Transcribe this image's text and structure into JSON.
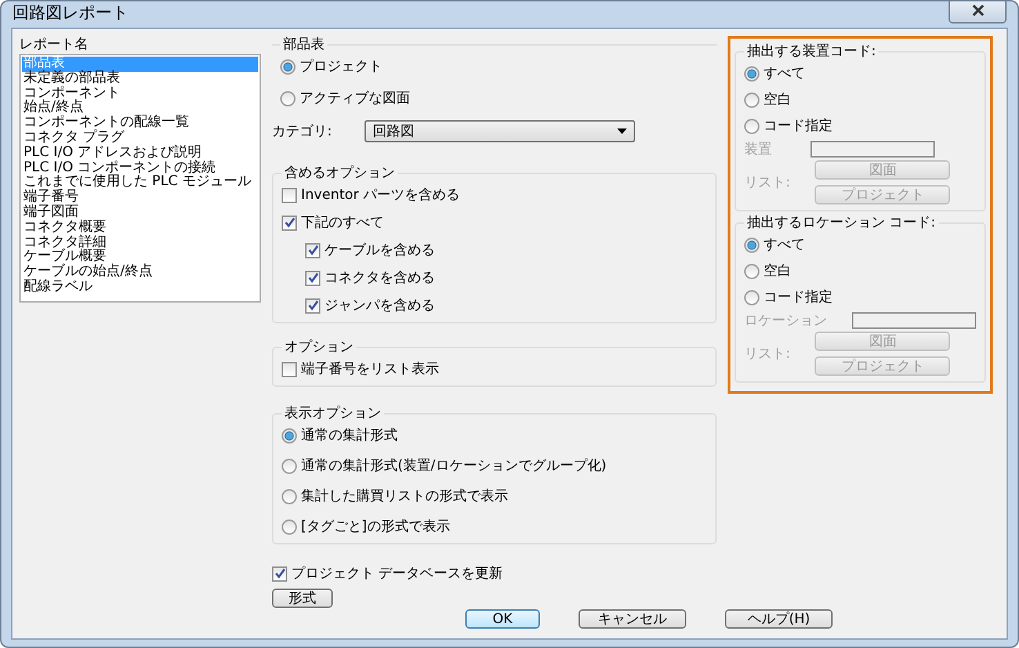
{
  "window": {
    "title": "回路図レポート"
  },
  "report_list": {
    "label": "レポート名",
    "items": [
      {
        "label": "部品表",
        "selected": true
      },
      {
        "label": "未定義の部品表",
        "selected": false
      },
      {
        "label": "コンポーネント",
        "selected": false
      },
      {
        "label": "始点/終点",
        "selected": false
      },
      {
        "label": "コンポーネントの配線一覧",
        "selected": false
      },
      {
        "label": "コネクタ プラグ",
        "selected": false
      },
      {
        "label": "PLC I/O アドレスおよび説明",
        "selected": false
      },
      {
        "label": "PLC I/O コンポーネントの接続",
        "selected": false
      },
      {
        "label": "これまでに使用した PLC モジュール",
        "selected": false
      },
      {
        "label": "端子番号",
        "selected": false
      },
      {
        "label": "端子図面",
        "selected": false
      },
      {
        "label": "コネクタ概要",
        "selected": false
      },
      {
        "label": "コネクタ詳細",
        "selected": false
      },
      {
        "label": "ケーブル概要",
        "selected": false
      },
      {
        "label": "ケーブルの始点/終点",
        "selected": false
      },
      {
        "label": "配線ラベル",
        "selected": false
      }
    ]
  },
  "parts_table": {
    "title": "部品表",
    "scope": [
      {
        "label": "プロジェクト",
        "selected": true
      },
      {
        "label": "アクティブな図面",
        "selected": false
      }
    ],
    "category": {
      "label": "カテゴリ:",
      "value": "回路図"
    }
  },
  "include_options": {
    "title": "含めるオプション",
    "items": [
      {
        "label": "Inventor パーツを含める",
        "checked": false
      },
      {
        "label": "下記のすべて",
        "checked": true,
        "children": [
          {
            "label": "ケーブルを含める",
            "checked": true
          },
          {
            "label": "コネクタを含める",
            "checked": true
          },
          {
            "label": "ジャンパを含める",
            "checked": true
          }
        ]
      }
    ]
  },
  "options": {
    "title": "オプション",
    "items": [
      {
        "label": "端子番号をリスト表示",
        "checked": false
      }
    ]
  },
  "display_options": {
    "title": "表示オプション",
    "items": [
      {
        "label": "通常の集計形式",
        "selected": true
      },
      {
        "label": "通常の集計形式(装置/ロケーションでグループ化)",
        "selected": false
      },
      {
        "label": "集計した購買リストの形式で表示",
        "selected": false
      },
      {
        "label": "[タグごと]の形式で表示",
        "selected": false
      }
    ]
  },
  "update_db": {
    "label": "プロジェクト データベースを更新",
    "checked": true
  },
  "format_button": "形式",
  "code_groups": [
    {
      "title": "抽出する装置コード:",
      "choices": [
        {
          "label": "すべて",
          "selected": true
        },
        {
          "label": "空白",
          "selected": false
        },
        {
          "label": "コード指定",
          "selected": false
        }
      ],
      "field_label": "装置",
      "list_label": "リスト:",
      "buttons": [
        "図面",
        "プロジェクト"
      ],
      "disabled": true
    },
    {
      "title": "抽出するロケーション コード:",
      "choices": [
        {
          "label": "すべて",
          "selected": true
        },
        {
          "label": "空白",
          "selected": false
        },
        {
          "label": "コード指定",
          "selected": false
        }
      ],
      "field_label": "ロケーション",
      "list_label": "リスト:",
      "buttons": [
        "図面",
        "プロジェクト"
      ],
      "disabled": true
    }
  ],
  "buttons": [
    {
      "label": "OK",
      "default": true
    },
    {
      "label": "キャンセル",
      "default": false
    },
    {
      "label": "ヘルプ(H)",
      "default": false
    }
  ]
}
